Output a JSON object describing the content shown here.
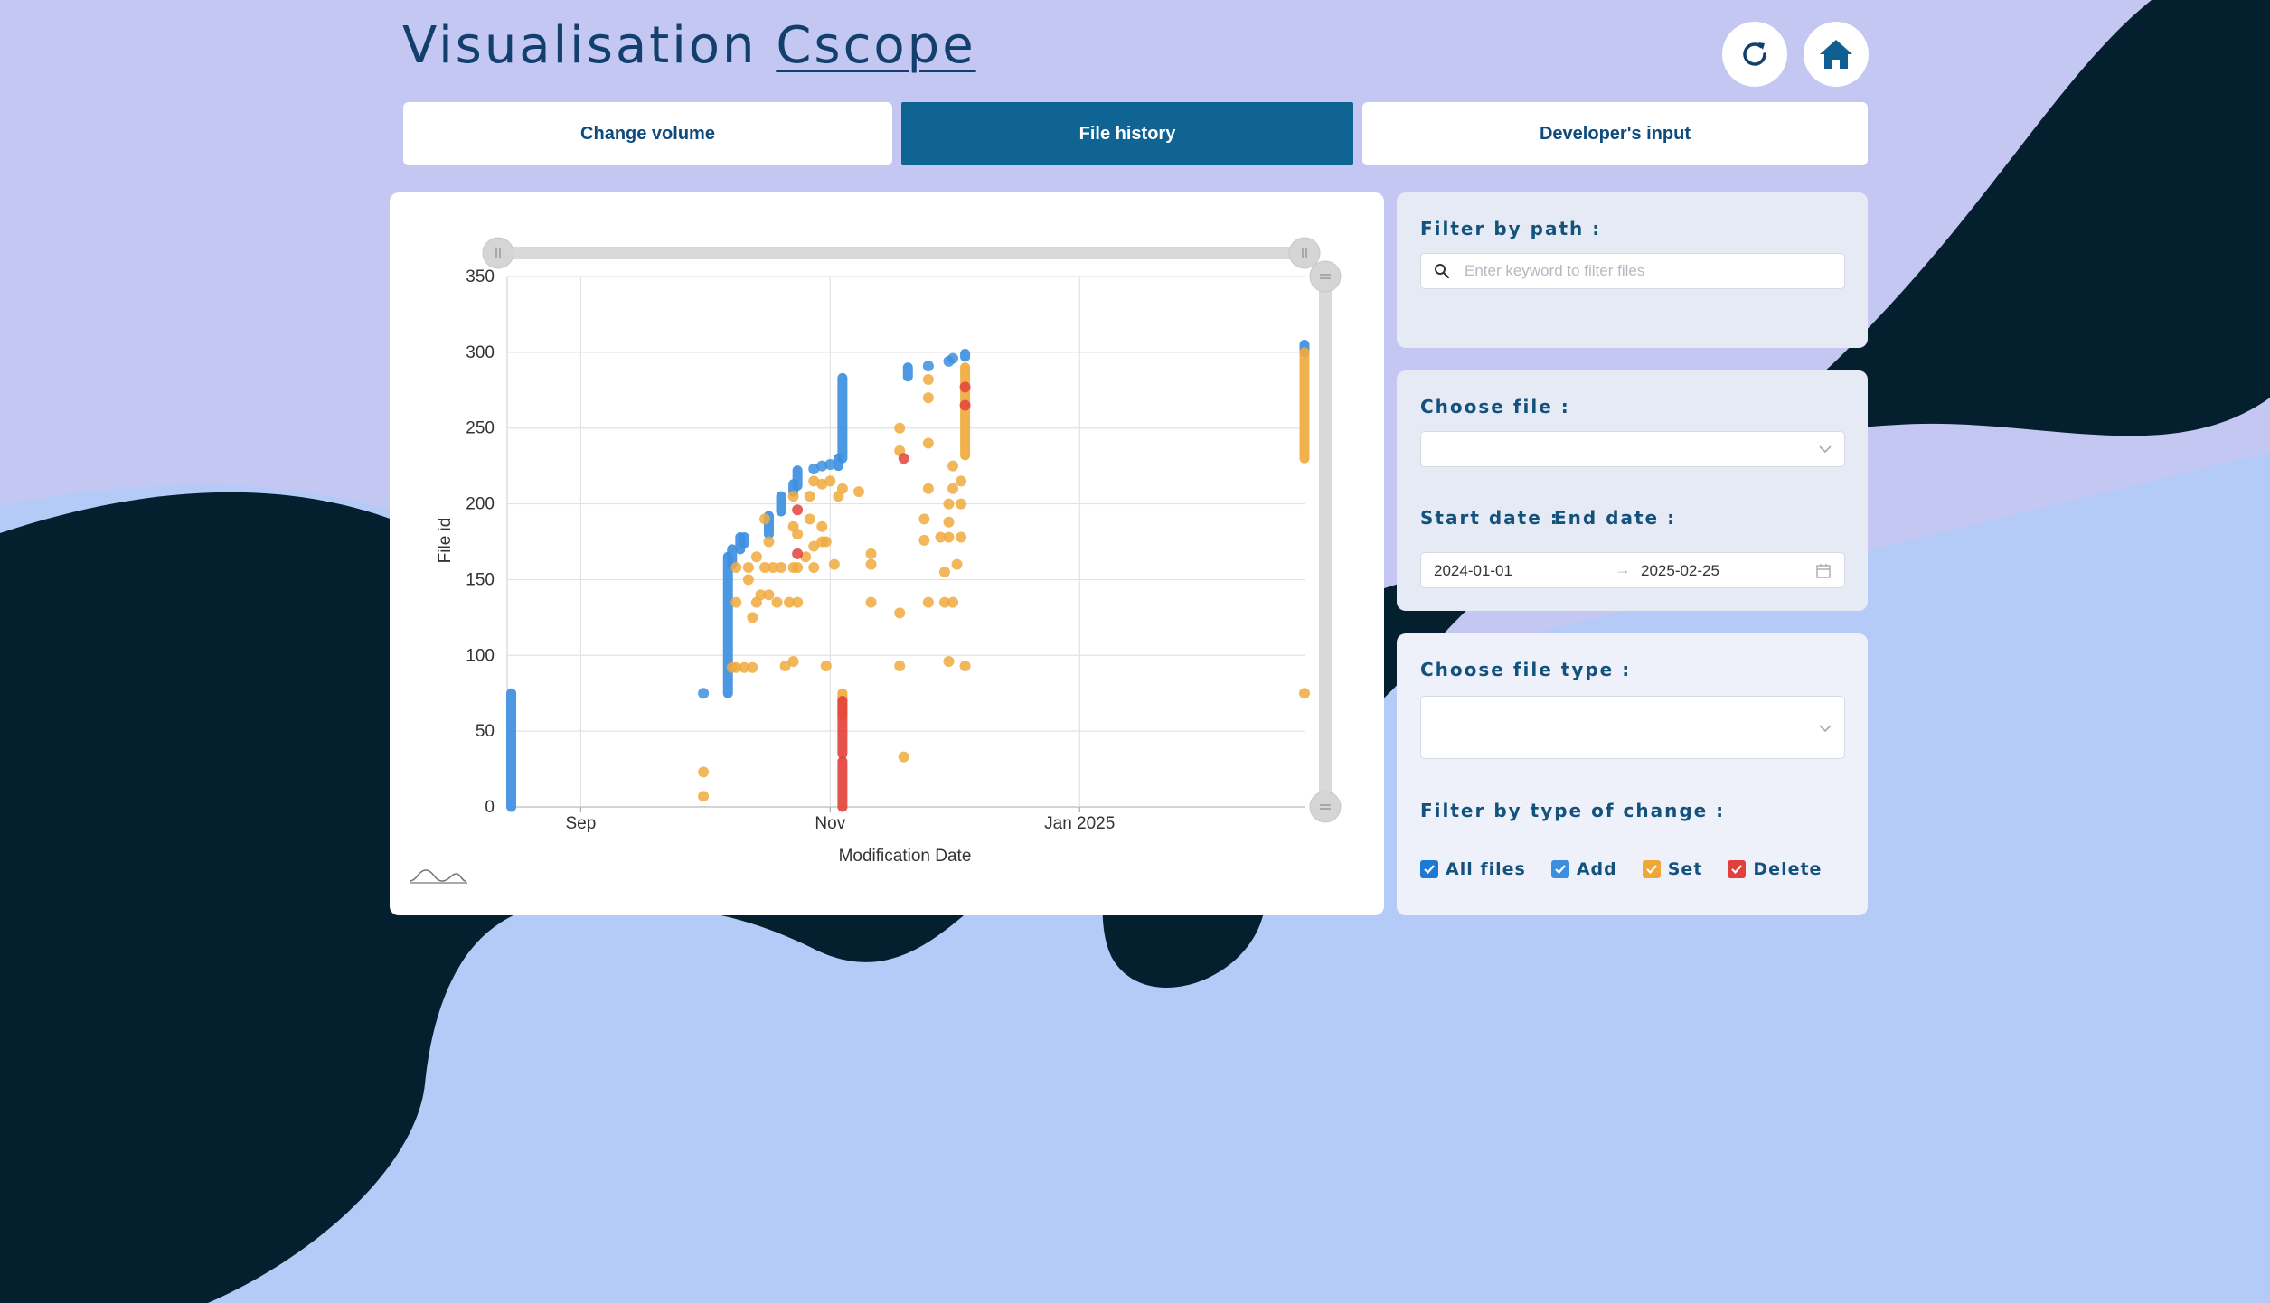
{
  "app": {
    "title_prefix": "Visualisation",
    "title_brand": "Cscope"
  },
  "header_icons": [
    "refresh-icon",
    "home-icon"
  ],
  "tabs": [
    {
      "label": "Change volume",
      "active": false
    },
    {
      "label": "File history",
      "active": true
    },
    {
      "label": "Developer's input",
      "active": false
    }
  ],
  "filters": {
    "path": {
      "label": "Filter by path :",
      "placeholder": "Enter keyword to filter files"
    },
    "file": {
      "label": "Choose file :",
      "value": ""
    },
    "start_label": "Start date :",
    "end_label": "End date :",
    "start_date": "2024-01-01",
    "end_date": "2025-02-25",
    "file_type": {
      "label": "Choose file type :",
      "value": ""
    },
    "change_label": "Filter by type of change :",
    "change_types": [
      {
        "label": "All files",
        "checked": true,
        "color": "#1e78d6"
      },
      {
        "label": "Add",
        "checked": true,
        "color": "#3a8fe0"
      },
      {
        "label": "Set",
        "checked": true,
        "color": "#f0a73a"
      },
      {
        "label": "Delete",
        "checked": true,
        "color": "#e2403c"
      }
    ]
  },
  "colors": {
    "add": "#3d8fe0",
    "set": "#f0aa3e",
    "delete": "#e4433d",
    "accent": "#106494",
    "dark_wave": "#04202f"
  },
  "chart_data": {
    "type": "scatter",
    "xlabel": "Modification Date",
    "ylabel": "File id",
    "x_ticks": [
      {
        "label": "Sep",
        "date": "2024-09-01"
      },
      {
        "label": "Nov",
        "date": "2024-11-01"
      },
      {
        "label": "Jan 2025",
        "date": "2025-01-01"
      }
    ],
    "x_range": [
      "2024-08-14",
      "2025-02-25"
    ],
    "ylim": [
      0,
      350
    ],
    "y_ticks": [
      0,
      50,
      100,
      150,
      200,
      250,
      300,
      350
    ],
    "grid": true,
    "series": [
      {
        "name": "Add",
        "color": "#3d8fe0",
        "points": [
          {
            "x": "2024-08-15",
            "y_from": 0,
            "y_to": 75
          },
          {
            "x": "2024-10-01",
            "y": 75
          },
          {
            "x": "2024-10-07",
            "y_from": 75,
            "y_to": 165
          },
          {
            "x": "2024-10-08",
            "y_from": 160,
            "y_to": 170
          },
          {
            "x": "2024-10-10",
            "y_from": 170,
            "y_to": 178
          },
          {
            "x": "2024-10-11",
            "y_from": 174,
            "y_to": 178
          },
          {
            "x": "2024-10-17",
            "y_from": 180,
            "y_to": 192
          },
          {
            "x": "2024-10-20",
            "y_from": 195,
            "y_to": 205
          },
          {
            "x": "2024-10-23",
            "y_from": 208,
            "y_to": 213
          },
          {
            "x": "2024-10-24",
            "y_from": 212,
            "y_to": 222
          },
          {
            "x": "2024-10-28",
            "y": 223
          },
          {
            "x": "2024-10-30",
            "y": 225
          },
          {
            "x": "2024-11-01",
            "y": 226
          },
          {
            "x": "2024-11-03",
            "y_from": 225,
            "y_to": 230
          },
          {
            "x": "2024-11-04",
            "y_from": 230,
            "y_to": 283
          },
          {
            "x": "2024-11-20",
            "y_from": 284,
            "y_to": 290
          },
          {
            "x": "2024-11-25",
            "y": 291
          },
          {
            "x": "2024-11-30",
            "y": 294
          },
          {
            "x": "2024-12-01",
            "y": 296
          },
          {
            "x": "2024-12-04",
            "y_from": 297,
            "y_to": 299
          },
          {
            "x": "2025-02-25",
            "y_from": 300,
            "y_to": 305
          }
        ]
      },
      {
        "name": "Set",
        "color": "#f0aa3e",
        "points": [
          {
            "x": "2024-10-01",
            "y": 23
          },
          {
            "x": "2024-10-01",
            "y": 7
          },
          {
            "x": "2024-10-08",
            "y": 92
          },
          {
            "x": "2024-10-09",
            "y": 92
          },
          {
            "x": "2024-10-11",
            "y": 92
          },
          {
            "x": "2024-10-13",
            "y": 92
          },
          {
            "x": "2024-10-21",
            "y": 93
          },
          {
            "x": "2024-10-23",
            "y": 96
          },
          {
            "x": "2024-10-31",
            "y": 93
          },
          {
            "x": "2024-10-09",
            "y": 135
          },
          {
            "x": "2024-10-12",
            "y": 150
          },
          {
            "x": "2024-10-13",
            "y": 125
          },
          {
            "x": "2024-10-14",
            "y": 135
          },
          {
            "x": "2024-10-15",
            "y": 140
          },
          {
            "x": "2024-10-17",
            "y": 140
          },
          {
            "x": "2024-10-19",
            "y": 135
          },
          {
            "x": "2024-10-22",
            "y": 135
          },
          {
            "x": "2024-10-24",
            "y": 135
          },
          {
            "x": "2024-10-09",
            "y": 158
          },
          {
            "x": "2024-10-12",
            "y": 158
          },
          {
            "x": "2024-10-14",
            "y": 165
          },
          {
            "x": "2024-10-16",
            "y": 158
          },
          {
            "x": "2024-10-18",
            "y": 158
          },
          {
            "x": "2024-10-20",
            "y": 158
          },
          {
            "x": "2024-10-23",
            "y": 158
          },
          {
            "x": "2024-10-24",
            "y": 158
          },
          {
            "x": "2024-10-26",
            "y": 165
          },
          {
            "x": "2024-10-28",
            "y": 172
          },
          {
            "x": "2024-10-30",
            "y": 175
          },
          {
            "x": "2024-10-28",
            "y": 158
          },
          {
            "x": "2024-10-16",
            "y": 190
          },
          {
            "x": "2024-10-17",
            "y": 175
          },
          {
            "x": "2024-10-23",
            "y": 185
          },
          {
            "x": "2024-10-24",
            "y": 180
          },
          {
            "x": "2024-10-27",
            "y": 190
          },
          {
            "x": "2024-10-30",
            "y": 185
          },
          {
            "x": "2024-10-31",
            "y": 175
          },
          {
            "x": "2024-10-23",
            "y": 205
          },
          {
            "x": "2024-10-27",
            "y": 205
          },
          {
            "x": "2024-10-28",
            "y": 215
          },
          {
            "x": "2024-10-30",
            "y": 213
          },
          {
            "x": "2024-11-01",
            "y": 215
          },
          {
            "x": "2024-11-04",
            "y": 210
          },
          {
            "x": "2024-11-08",
            "y": 208
          },
          {
            "x": "2024-11-02",
            "y": 160
          },
          {
            "x": "2024-11-11",
            "y": 160
          },
          {
            "x": "2024-11-11",
            "y": 167
          },
          {
            "x": "2024-11-11",
            "y": 135
          },
          {
            "x": "2024-11-03",
            "y": 205
          },
          {
            "x": "2024-11-04",
            "y_from": 60,
            "y_to": 75
          },
          {
            "x": "2024-11-18",
            "y": 250
          },
          {
            "x": "2024-11-18",
            "y": 235
          },
          {
            "x": "2024-11-18",
            "y": 128
          },
          {
            "x": "2024-11-18",
            "y": 93
          },
          {
            "x": "2024-11-19",
            "y": 33
          },
          {
            "x": "2024-11-24",
            "y": 176
          },
          {
            "x": "2024-11-24",
            "y": 190
          },
          {
            "x": "2024-11-25",
            "y": 135
          },
          {
            "x": "2024-11-25",
            "y": 210
          },
          {
            "x": "2024-11-25",
            "y": 240
          },
          {
            "x": "2024-11-25",
            "y": 270
          },
          {
            "x": "2024-11-25",
            "y": 282
          },
          {
            "x": "2024-11-28",
            "y": 178
          },
          {
            "x": "2024-11-30",
            "y": 178
          },
          {
            "x": "2024-11-30",
            "y": 188
          },
          {
            "x": "2024-11-30",
            "y": 200
          },
          {
            "x": "2024-12-01",
            "y": 210
          },
          {
            "x": "2024-12-01",
            "y": 225
          },
          {
            "x": "2024-11-29",
            "y": 135
          },
          {
            "x": "2024-12-01",
            "y": 135
          },
          {
            "x": "2024-11-30",
            "y": 96
          },
          {
            "x": "2024-11-29",
            "y": 155
          },
          {
            "x": "2024-12-02",
            "y": 160
          },
          {
            "x": "2024-12-03",
            "y": 178
          },
          {
            "x": "2024-12-03",
            "y": 200
          },
          {
            "x": "2024-12-03",
            "y": 215
          },
          {
            "x": "2024-12-04",
            "y": 93
          },
          {
            "x": "2024-12-04",
            "y_from": 232,
            "y_to": 290
          },
          {
            "x": "2025-02-25",
            "y_from": 230,
            "y_to": 300
          },
          {
            "x": "2025-02-25",
            "y": 75
          }
        ]
      },
      {
        "name": "Delete",
        "color": "#e4433d",
        "points": [
          {
            "x": "2024-11-04",
            "y_from": 0,
            "y_to": 30
          },
          {
            "x": "2024-11-04",
            "y_from": 35,
            "y_to": 70
          },
          {
            "x": "2024-10-24",
            "y": 196
          },
          {
            "x": "2024-10-24",
            "y": 167
          },
          {
            "x": "2024-11-19",
            "y": 230
          },
          {
            "x": "2024-12-04",
            "y": 265
          },
          {
            "x": "2024-12-04",
            "y": 277
          }
        ]
      }
    ]
  }
}
